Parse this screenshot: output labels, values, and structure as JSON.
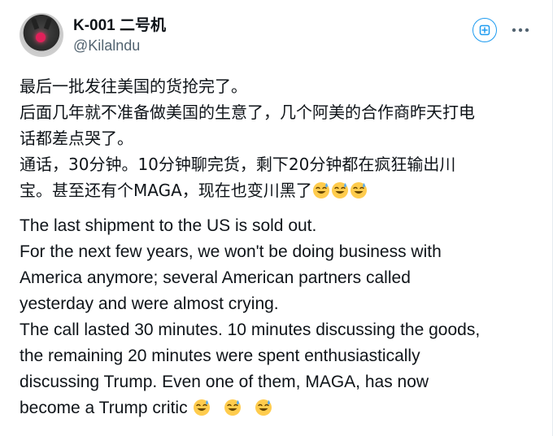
{
  "user": {
    "display_name": "K-001 二号机",
    "handle": "@Kilalndu"
  },
  "icons": {
    "avatar": "avatar-image",
    "grok": "grok-icon",
    "more": "more-options-icon",
    "emoji": "grinning-face-with-sweat-emoji"
  },
  "colors": {
    "accent": "#1d9bf0",
    "text": "#0f1419",
    "secondary": "#536471"
  },
  "post": {
    "zh_lines": [
      "最后一批发往美国的货抢完了。",
      "后面几年就不准备做美国的生意了，几个阿美的合作商昨天打电",
      "话都差点哭了。",
      "通话，30分钟。10分钟聊完货，剩下20分钟都在疯狂输出川",
      "宝。甚至还有个MAGA，现在也变川黑了"
    ],
    "en_lines": [
      "The last shipment to the US is sold out.",
      "For the next few years, we won't be doing business with",
      "America anymore; several American partners called",
      "yesterday and were almost crying.",
      "The call lasted 30 minutes. 10 minutes discussing the goods,",
      "the remaining 20 minutes were spent enthusiastically",
      "discussing Trump. Even one of them, MAGA, has now",
      "become a Trump critic"
    ]
  }
}
